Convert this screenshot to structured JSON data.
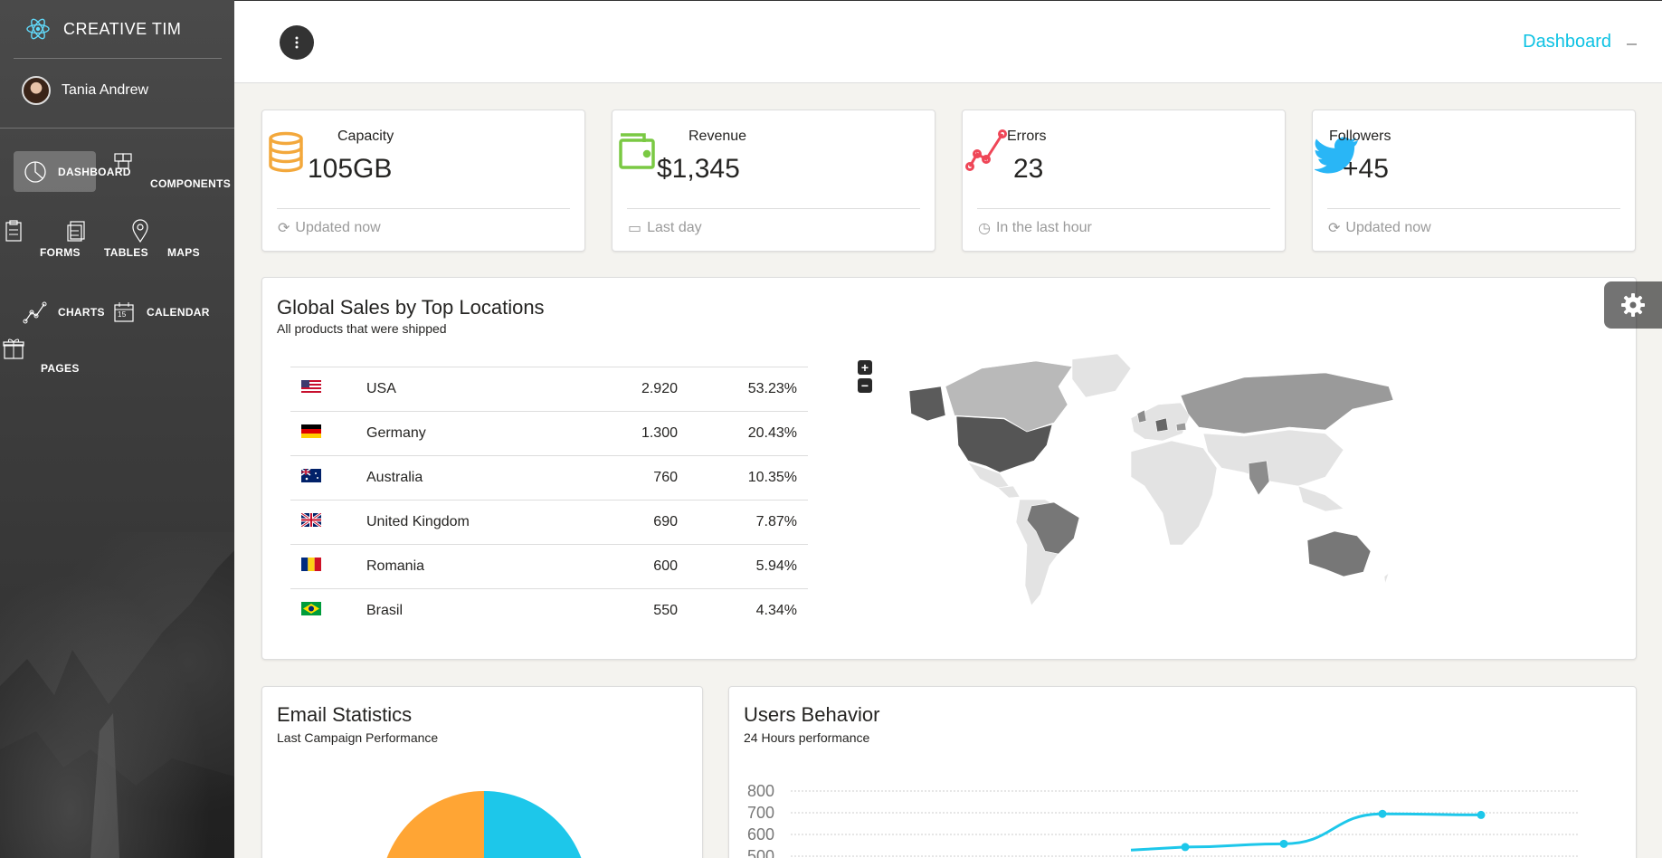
{
  "brand": {
    "logo_text": "CREATIVE TIM"
  },
  "user": {
    "name": "Tania Andrew"
  },
  "nav": [
    {
      "id": "dashboard",
      "label": "DASHBOARD",
      "icon": "pie-chart-icon",
      "active": true
    },
    {
      "id": "components",
      "label": "COMPONENTS",
      "icon": "cubes-icon"
    },
    {
      "id": "forms",
      "label": "FORMS",
      "icon": "clipboard-icon"
    },
    {
      "id": "tables",
      "label": "TABLES",
      "icon": "notes-icon"
    },
    {
      "id": "maps",
      "label": "MAPS",
      "icon": "map-pin-icon"
    },
    {
      "id": "charts",
      "label": "CHARTS",
      "icon": "line-chart-icon"
    },
    {
      "id": "calendar",
      "label": "CALENDAR",
      "icon": "calendar-icon"
    },
    {
      "id": "pages",
      "label": "PAGES",
      "icon": "gift-icon"
    }
  ],
  "calendar_day": "15",
  "topbar": {
    "title": "Dashboard"
  },
  "stats": [
    {
      "label": "Capacity",
      "value": "105GB",
      "footer": "Updated now",
      "icon": "database-icon",
      "footer_icon": "refresh-icon",
      "color": "#f3bb45"
    },
    {
      "label": "Revenue",
      "value": "$1,345",
      "footer": "Last day",
      "icon": "wallet-icon",
      "footer_icon": "calendar-icon",
      "color": "#7ac29a"
    },
    {
      "label": "Errors",
      "value": "23",
      "footer": "In the last hour",
      "icon": "pulse-icon",
      "footer_icon": "clock-icon",
      "color": "#eb5e28"
    },
    {
      "label": "Followers",
      "value": "+45",
      "footer": "Updated now",
      "icon": "twitter-icon",
      "footer_icon": "refresh-icon",
      "color": "#00bbe0"
    }
  ],
  "sales": {
    "title": "Global Sales by Top Locations",
    "subtitle": "All products that were shipped",
    "rows": [
      {
        "country": "USA",
        "value": "2.920",
        "percent": "53.23%",
        "flag": "us"
      },
      {
        "country": "Germany",
        "value": "1.300",
        "percent": "20.43%",
        "flag": "de"
      },
      {
        "country": "Australia",
        "value": "760",
        "percent": "10.35%",
        "flag": "au"
      },
      {
        "country": "United Kingdom",
        "value": "690",
        "percent": "7.87%",
        "flag": "gb"
      },
      {
        "country": "Romania",
        "value": "600",
        "percent": "5.94%",
        "flag": "ro"
      },
      {
        "country": "Brasil",
        "value": "550",
        "percent": "4.34%",
        "flag": "br"
      }
    ],
    "zoom_in": "+",
    "zoom_out": "−"
  },
  "email": {
    "title": "Email Statistics",
    "subtitle": "Last Campaign Performance"
  },
  "users_behavior": {
    "title": "Users Behavior",
    "subtitle": "24 Hours performance",
    "chart_data": {
      "type": "line",
      "ylim": [
        500,
        800
      ],
      "yticks": [
        "800",
        "700",
        "600",
        "500"
      ],
      "x": [
        4,
        5,
        6,
        7
      ],
      "series": [
        {
          "values": [
            542,
            557,
            695,
            690
          ]
        }
      ],
      "color": "#1dc7ea"
    }
  }
}
